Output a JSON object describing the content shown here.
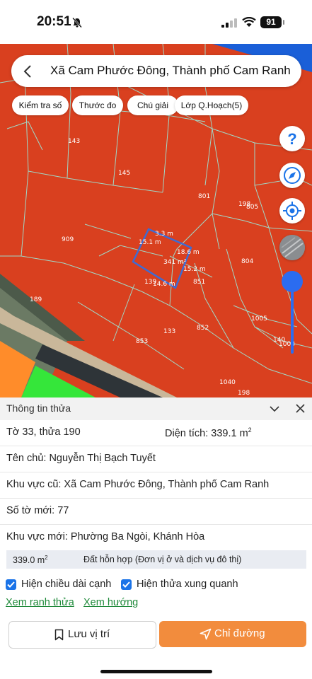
{
  "status_bar": {
    "time": "20:51",
    "battery": "91"
  },
  "search": {
    "text": "Xã Cam Phước Đông, Thành phố Cam Ranh"
  },
  "chips": [
    "Kiểm tra số",
    "Thước đo",
    "Chú giải",
    "Lớp Q.Hoạch(5)"
  ],
  "map": {
    "parcel_labels": [
      "143",
      "145",
      "801",
      "198",
      "805",
      "909",
      "804",
      "851",
      "139",
      "189",
      "1005",
      "852",
      "133",
      "853",
      "1040",
      "198",
      "140",
      "1008"
    ],
    "area_label": "341 m²",
    "edge_labels": [
      "3.3 m",
      "15.1 m",
      "18.6 m",
      "14.6 m",
      "15.2 m"
    ],
    "colors": {
      "zone": "#d9401f",
      "zone_edge": "#9fd9c8",
      "selected": "#3d6bd4",
      "road": "#c9b79a",
      "water": "#1a5fd8",
      "green": "#35e63a",
      "orange": "#ff8c2a"
    }
  },
  "panel": {
    "title": "Thông tin thửa",
    "sheet_parcel": "Tờ 33, thửa 190",
    "area_label": "Diện tích: 339.1 m",
    "area_sup": "2",
    "owner": "Tên chủ: Nguyễn Thị Bạch Tuyết",
    "old_area": "Khu vực cũ: Xã Cam Phước Đông, Thành phố Cam Ranh",
    "new_sheet": "Số tờ mới: 77",
    "new_area": "Khu vực mới: Phường Ba Ngòi, Khánh Hòa",
    "land_area": "339.0 m",
    "land_area_sup": "2",
    "land_type": "Đất hỗn hợp (Đơn vị ở và dịch vụ đô thị)",
    "check_edges": "Hiện chiều dài cạnh",
    "check_neighbors": "Hiện thửa xung quanh",
    "link_boundary": "Xem ranh thửa",
    "link_direction": "Xem hướng",
    "save_button": "Lưu vị trí",
    "directions_button": "Chỉ đường"
  },
  "icons": [
    "bell-slash-icon",
    "signal-icon",
    "wifi-icon",
    "back-icon",
    "help-icon",
    "compass-icon",
    "locate-icon",
    "layer-thumbnail",
    "chevron-down-icon",
    "close-icon",
    "checkbox-icon",
    "bookmark-icon",
    "navigation-arrow-icon"
  ]
}
